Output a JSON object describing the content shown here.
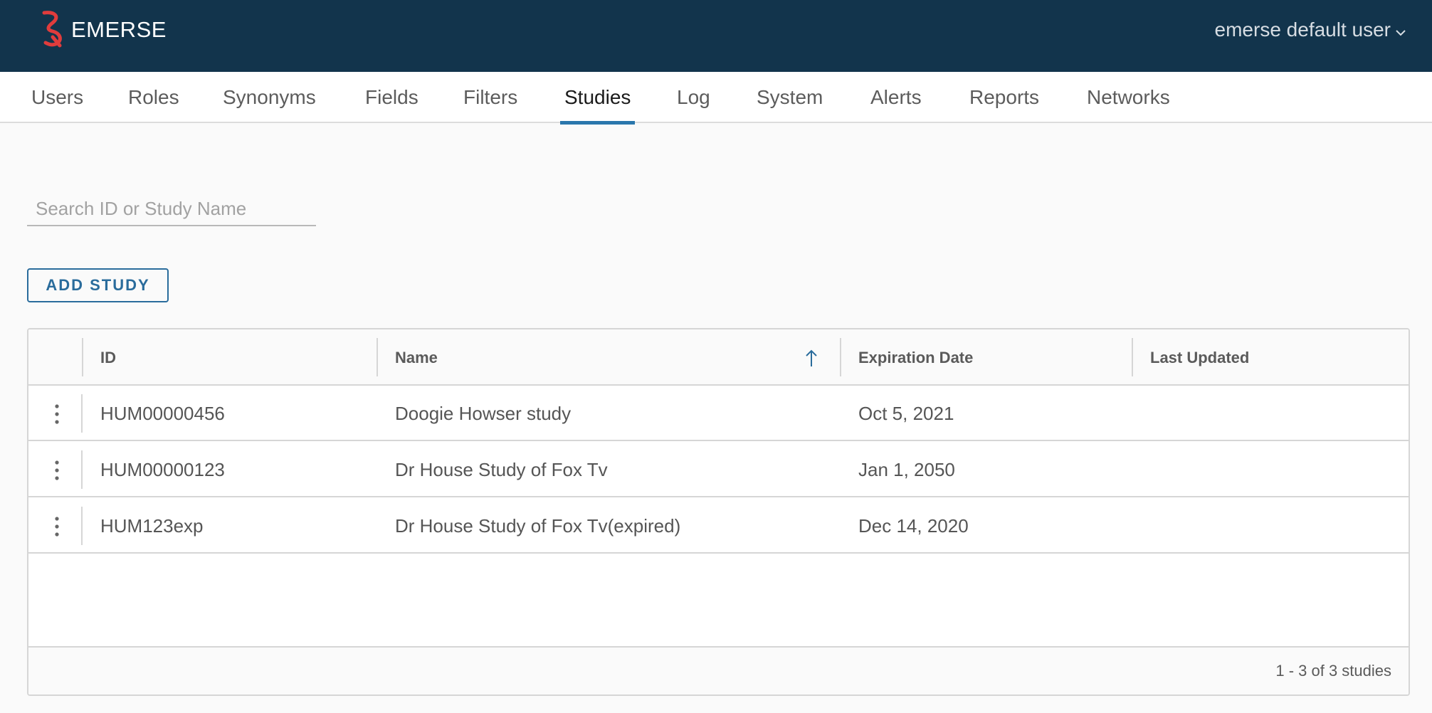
{
  "header": {
    "app_name": "EMERSE",
    "user_name": "emerse default user",
    "logo_icon": "emerse-logo-icon",
    "brand_color": "#12344c",
    "accent_color": "#e03c3c"
  },
  "tabs": [
    {
      "label": "Users"
    },
    {
      "label": "Roles"
    },
    {
      "label": "Synonyms"
    },
    {
      "label": "Fields"
    },
    {
      "label": "Filters"
    },
    {
      "label": "Studies",
      "active": true
    },
    {
      "label": "Log"
    },
    {
      "label": "System"
    },
    {
      "label": "Alerts"
    },
    {
      "label": "Reports"
    },
    {
      "label": "Networks"
    }
  ],
  "search": {
    "placeholder": "Search ID or Study Name",
    "value": ""
  },
  "add_button": {
    "label": "ADD STUDY"
  },
  "grid": {
    "columns": [
      "ID",
      "Name",
      "Expiration Date",
      "Last Updated"
    ],
    "sorted_column": "Name",
    "sort_direction": "ascending",
    "rows": [
      {
        "id": "HUM00000456",
        "name": "Doogie Howser study",
        "expiration": "Oct 5, 2021",
        "updated": ""
      },
      {
        "id": "HUM00000123",
        "name": "Dr House Study of Fox Tv",
        "expiration": "Jan 1, 2050",
        "updated": ""
      },
      {
        "id": "HUM123exp",
        "name": "Dr House Study of Fox Tv(expired)",
        "expiration": "Dec 14, 2020",
        "updated": ""
      }
    ],
    "footer": "1 - 3 of 3 studies"
  }
}
